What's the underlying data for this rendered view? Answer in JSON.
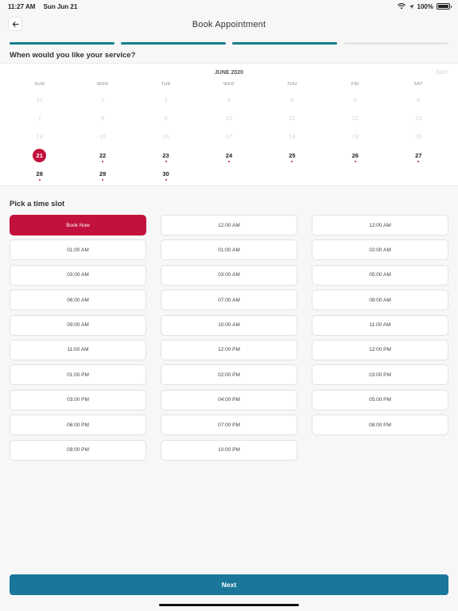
{
  "status_bar": {
    "time": "11:27 AM",
    "date": "Sun Jun 21",
    "battery_text": "100%",
    "battery_level": 1.0
  },
  "header": {
    "title": "Book Appointment",
    "back_icon": "arrow-left-icon"
  },
  "progress": {
    "total_steps": 4,
    "completed_steps": 3,
    "active_color": "#177f8b"
  },
  "question": "When would you like your service?",
  "calendar": {
    "current_month": "JUNE 2020",
    "next_month": "JULY",
    "weekdays": [
      "SUN",
      "MON",
      "TUE",
      "WED",
      "THU",
      "FRI",
      "SAT"
    ],
    "selected_color": "#c2113c",
    "weeks": [
      [
        {
          "d": "31",
          "dis": true
        },
        {
          "d": "1",
          "dis": true
        },
        {
          "d": "2",
          "dis": true
        },
        {
          "d": "3",
          "dis": true
        },
        {
          "d": "4",
          "dis": true
        },
        {
          "d": "5",
          "dis": true
        },
        {
          "d": "6",
          "dis": true
        }
      ],
      [
        {
          "d": "7",
          "dis": true
        },
        {
          "d": "8",
          "dis": true
        },
        {
          "d": "9",
          "dis": true
        },
        {
          "d": "10",
          "dis": true
        },
        {
          "d": "11",
          "dis": true
        },
        {
          "d": "12",
          "dis": true
        },
        {
          "d": "13",
          "dis": true
        }
      ],
      [
        {
          "d": "14",
          "dis": true
        },
        {
          "d": "15",
          "dis": true
        },
        {
          "d": "16",
          "dis": true
        },
        {
          "d": "17",
          "dis": true
        },
        {
          "d": "18",
          "dis": true
        },
        {
          "d": "19",
          "dis": true
        },
        {
          "d": "20",
          "dis": true
        }
      ],
      [
        {
          "d": "21",
          "sel": true
        },
        {
          "d": "22",
          "dot": true
        },
        {
          "d": "23",
          "dot": true
        },
        {
          "d": "24",
          "dot": true
        },
        {
          "d": "25",
          "dot": true
        },
        {
          "d": "26",
          "dot": true
        },
        {
          "d": "27",
          "dot": true
        }
      ],
      [
        {
          "d": "28",
          "dot": true
        },
        {
          "d": "29",
          "dot": true
        },
        {
          "d": "30",
          "dot": true
        },
        null,
        null,
        null,
        null
      ]
    ]
  },
  "time_slot": {
    "title": "Pick a time slot",
    "active_color": "#c2113c",
    "columns": [
      [
        "Book Now",
        "01:00 AM",
        "03:00 AM",
        "06:00 AM",
        "09:00 AM",
        "11:00 AM",
        "01:00 PM",
        "03:00 PM",
        "06:00 PM",
        "09:00 PM"
      ],
      [
        "12:00 AM",
        "01:00 AM",
        "03:00 AM",
        "07:00 AM",
        "10:00 AM",
        "12:00 PM",
        "02:00 PM",
        "04:00 PM",
        "07:00 PM",
        "10:00 PM"
      ],
      [
        "12:00 AM",
        "02:00 AM",
        "05:00 AM",
        "08:00 AM",
        "11:00 AM",
        "12:00 PM",
        "03:00 PM",
        "05:00 PM",
        "08:00 PM"
      ]
    ],
    "active_slot": "Book Now"
  },
  "footer": {
    "next_label": "Next",
    "button_color": "#1a7799"
  }
}
